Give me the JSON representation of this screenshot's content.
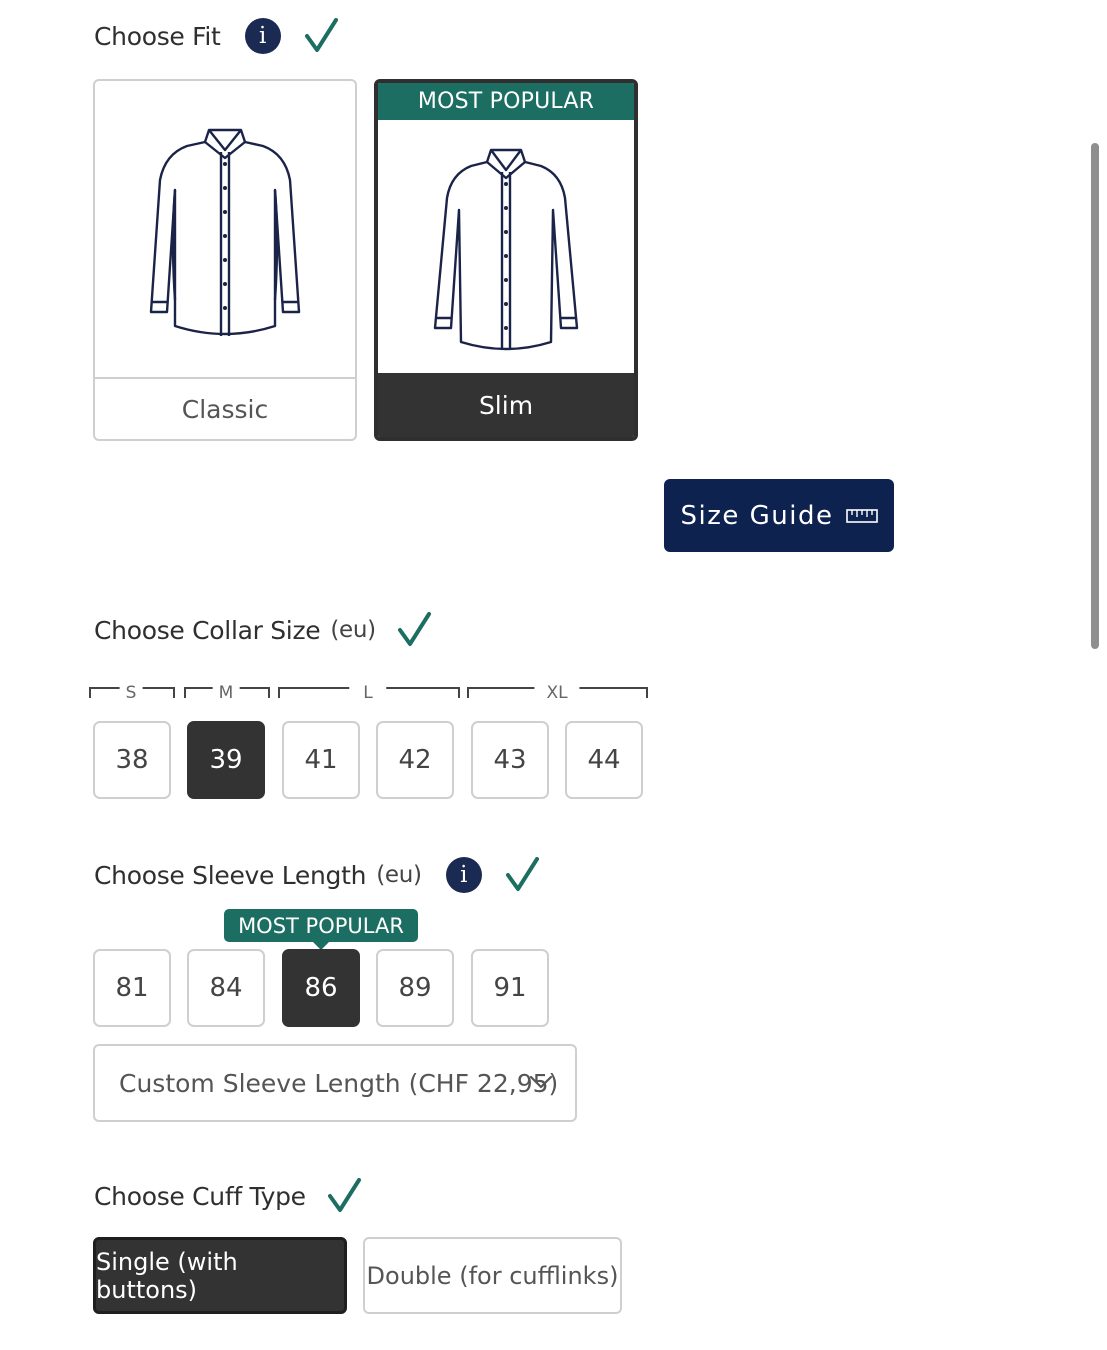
{
  "fit": {
    "title": "Choose Fit",
    "info_symbol": "i",
    "options": [
      {
        "label": "Classic",
        "selected": false
      },
      {
        "label": "Slim",
        "selected": true,
        "badge": "MOST POPULAR"
      }
    ],
    "size_guide_label": "Size Guide"
  },
  "collar": {
    "title": "Choose Collar Size",
    "unit": "(eu)",
    "ranges": [
      "S",
      "M",
      "L",
      "XL"
    ],
    "sizes": [
      "38",
      "39",
      "41",
      "42",
      "43",
      "44"
    ],
    "selected": "39"
  },
  "sleeve": {
    "title": "Choose Sleeve Length",
    "unit": "(eu)",
    "info_symbol": "i",
    "popular_badge": "MOST POPULAR",
    "lengths": [
      "81",
      "84",
      "86",
      "89",
      "91"
    ],
    "selected": "86",
    "custom_label": "Custom Sleeve Length (CHF 22,95)"
  },
  "cuff": {
    "title": "Choose Cuff Type",
    "options": [
      "Single (with buttons)",
      "Double (for cufflinks)"
    ],
    "selected": "Single (with buttons)"
  },
  "colors": {
    "accent_green": "#1c6e62",
    "navy": "#0e2250",
    "info_navy": "#1b2a52",
    "selected_dark": "#333333",
    "border": "#cfcfcf"
  },
  "icons": [
    "info-icon",
    "check-icon",
    "shirt-icon",
    "ruler-icon",
    "chevron-down-icon"
  ]
}
